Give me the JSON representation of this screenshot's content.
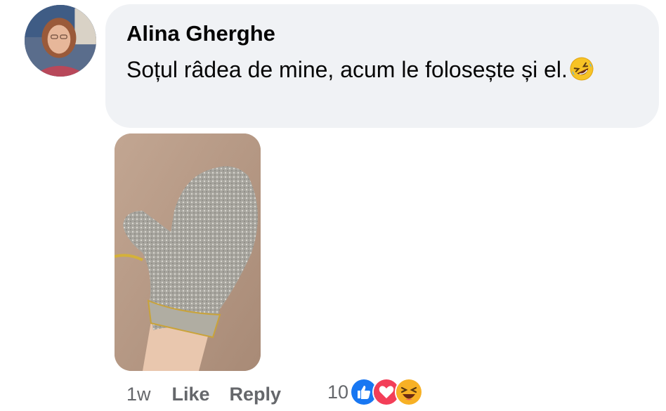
{
  "comment": {
    "author": "Alina Gherghe",
    "text": "Soțul râdea de mine, acum le folosește și el.",
    "emoji": "rolling-on-floor-laughing"
  },
  "meta": {
    "time": "1w",
    "like_label": "Like",
    "reply_label": "Reply",
    "reaction_count": "10",
    "reactions": [
      "like",
      "love",
      "haha"
    ]
  },
  "colors": {
    "bubble_bg": "#f0f2f5",
    "secondary_text": "#65676b",
    "like_blue": "#1877f2",
    "love_red": "#f33e58",
    "haha_yellow": "#f7b125"
  }
}
